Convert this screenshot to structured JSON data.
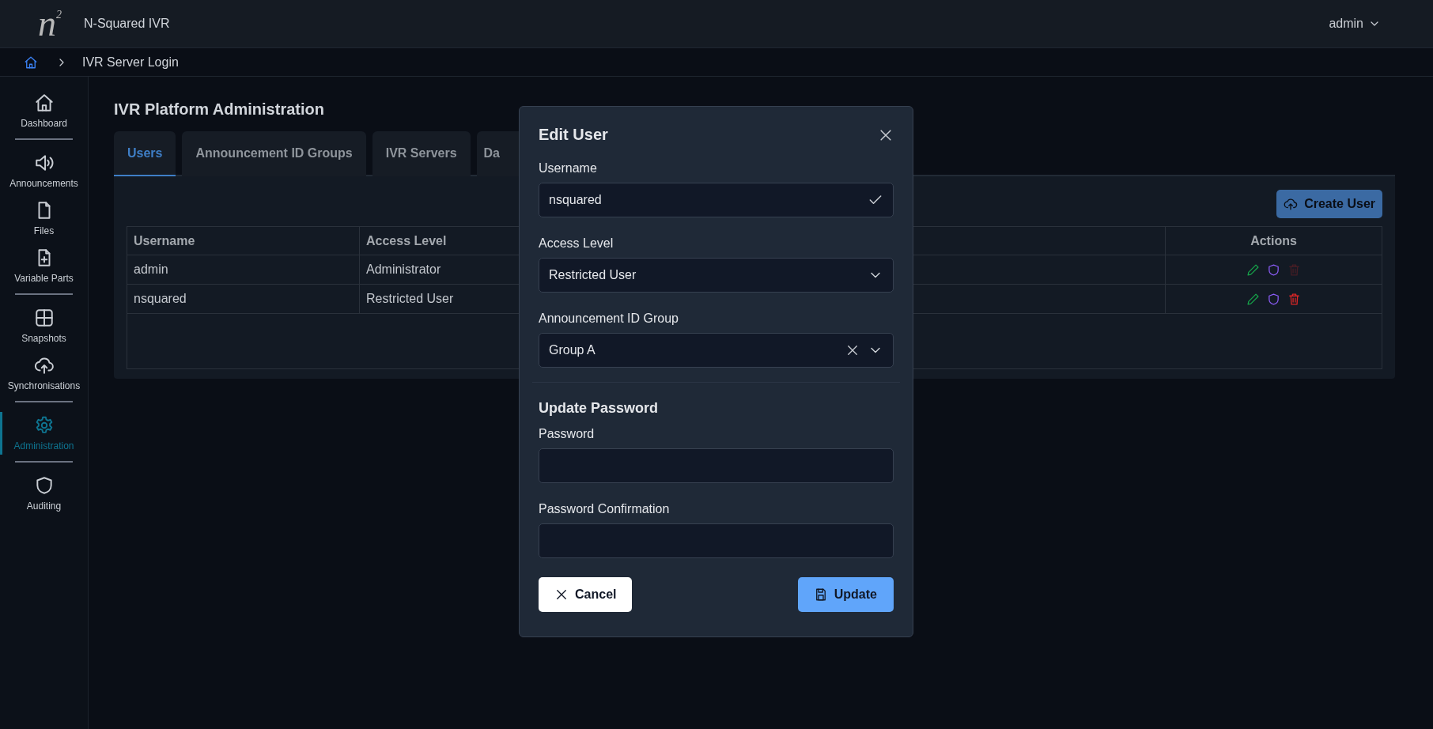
{
  "header": {
    "logo": "n$^{2}$",
    "app_name": "N-Squared IVR",
    "user_menu": "admin"
  },
  "breadcrumb": {
    "items": [
      "IVR Server Login"
    ]
  },
  "sidebar": {
    "groups": [
      {
        "items": [
          {
            "label": "Dashboard",
            "selected": false
          }
        ]
      },
      {
        "items": [
          {
            "label": "Announcements",
            "selected": false
          },
          {
            "label": "Files",
            "selected": false
          },
          {
            "label": "Variable Parts",
            "selected": false
          }
        ]
      },
      {
        "items": [
          {
            "label": "Snapshots",
            "selected": false
          },
          {
            "label": "Synchronisations",
            "selected": false
          }
        ]
      },
      {
        "items": [
          {
            "label": "Administration",
            "selected": true
          }
        ]
      },
      {
        "items": [
          {
            "label": "Auditing",
            "selected": false
          }
        ]
      }
    ]
  },
  "page_title": "IVR Platform Administration",
  "tabs": [
    {
      "label": "Users",
      "selected": true
    },
    {
      "label": "Announcement ID Groups",
      "selected": false
    },
    {
      "label": "IVR Servers",
      "selected": false
    },
    {
      "label": "Da",
      "selected": false
    }
  ],
  "create_button": "Create User",
  "table": {
    "columns": [
      "Username",
      "Access Level",
      "Actions"
    ],
    "rows": [
      {
        "cells": [
          "admin",
          "Administrator"
        ],
        "delete_disabled": true
      },
      {
        "cells": [
          "nsquared",
          "Restricted User"
        ],
        "delete_disabled": false
      }
    ]
  },
  "dialog": {
    "title": "Edit User",
    "fields": [
      {
        "kind": "text",
        "label": "Username",
        "value": "nsquared",
        "valid": true
      },
      {
        "kind": "select",
        "label": "Access Level",
        "value": "Restricted User",
        "clearable": false
      },
      {
        "kind": "select",
        "label": "Announcement ID Group",
        "value": "Group A",
        "clearable": true
      }
    ],
    "section_title": "Update Password",
    "password_fields": [
      {
        "label": "Password"
      },
      {
        "label": "Password Confirmation"
      }
    ],
    "cancel": "Cancel",
    "submit": "Update"
  }
}
